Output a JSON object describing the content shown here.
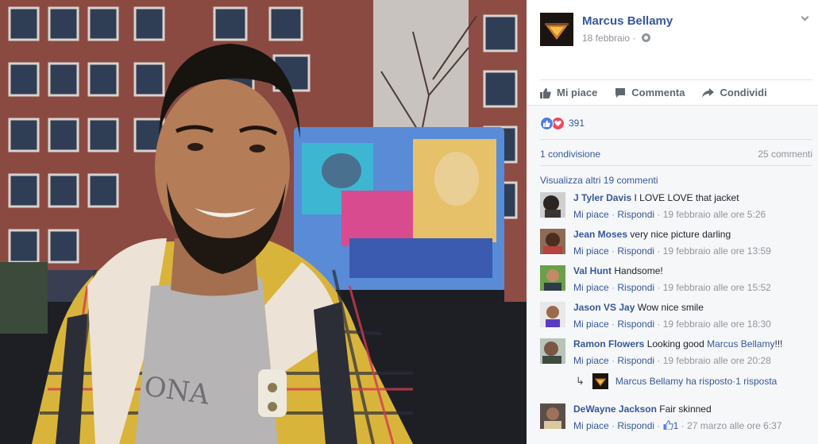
{
  "post": {
    "author": "Marcus Bellamy",
    "date": "18 febbraio",
    "date_separator": " · "
  },
  "actions": {
    "like": "Mi piace",
    "comment": "Commenta",
    "share": "Condividi"
  },
  "stats": {
    "reaction_count": "391",
    "shares": "1 condivisione",
    "comments": "25 commenti"
  },
  "more_comments": "Visualizza altri 19 commenti",
  "comment_meta": {
    "like": "Mi piace",
    "reply": "Rispondi",
    "sep": " · "
  },
  "comments": [
    {
      "author": "J Tyler Davis",
      "text": "I LOVE LOVE that jacket",
      "time": "19 febbraio alle ore 5:26"
    },
    {
      "author": "Jean Moses",
      "text": "very nice picture darling",
      "time": "19 febbraio alle ore 13:59"
    },
    {
      "author": "Val Hunt",
      "text": "Handsome!",
      "time": "19 febbraio alle ore 15:52"
    },
    {
      "author": "Jason VS Jay",
      "text": "Wow nice smile",
      "time": "19 febbraio alle ore 18:30"
    },
    {
      "author": "Ramon Flowers",
      "text": "Looking good",
      "mention": "Marcus Bellamy",
      "suffix": "!!!",
      "time": "19 febbraio alle ore 20:28"
    },
    {
      "author": "DeWayne Jackson",
      "text": "Fair skinned",
      "likes": "1",
      "time": "27 marzo alle ore 6:37"
    }
  ],
  "reply": {
    "text": "Marcus Bellamy ha risposto",
    "count": "1 risposta"
  },
  "colors": {
    "link": "#365899",
    "meta": "#90949c",
    "like_reaction": "#4d7de7",
    "love_reaction": "#f0485e"
  }
}
